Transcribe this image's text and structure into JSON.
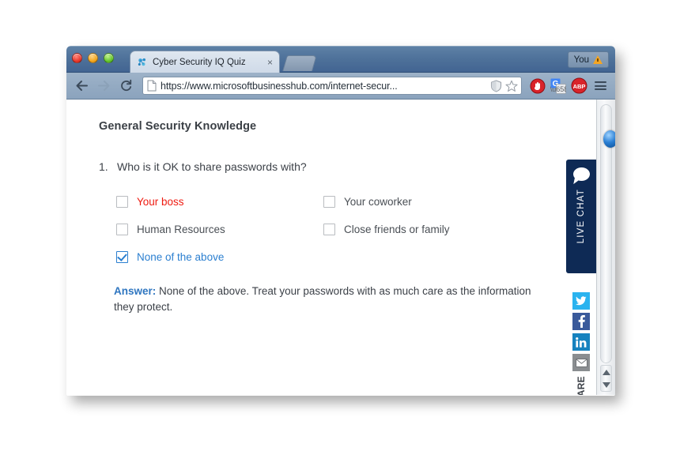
{
  "browser": {
    "window_controls": [
      {
        "name": "close",
        "color": "#e8392c"
      },
      {
        "name": "minimize",
        "color": "#f3a71d"
      },
      {
        "name": "zoom",
        "color": "#66c72e"
      }
    ],
    "tab": {
      "title": "Cyber Security IQ Quiz",
      "favicon": "molecule-icon",
      "close_label": "×"
    },
    "new_tab_label": "",
    "profile": {
      "label": "You",
      "warning_icon": "warning-triangle-icon"
    },
    "nav": {
      "back_icon": "arrow-left-icon",
      "forward_icon": "arrow-right-icon",
      "reload_icon": "reload-icon"
    },
    "address_bar": {
      "page_icon": "page-document-icon",
      "url": "https://www.microsoftbusinesshub.com/internet-secur...",
      "url_prefix": "https://www.microsoftbusinesshub.com",
      "url_suffix": "/internet-secur...",
      "shield_icon": "shield-icon",
      "bookmark_icon": "star-icon"
    },
    "extensions": [
      {
        "name": "block-stop-icon",
        "label": "",
        "color": "#d9232a"
      },
      {
        "name": "google-translate-icon",
        "label": "G",
        "color": "#4285f4"
      },
      {
        "name": "adblock-plus-icon",
        "label": "ABP",
        "color": "#d9232a"
      }
    ],
    "menu_icon": "hamburger-menu-icon"
  },
  "page": {
    "heading": "General Security Knowledge",
    "question": {
      "number": "1.",
      "text": "Who is it OK to share passwords with?"
    },
    "options": [
      {
        "label": "Your boss",
        "checked": false,
        "color": "red"
      },
      {
        "label": "Your coworker",
        "checked": false,
        "color": "gray"
      },
      {
        "label": "Human Resources",
        "checked": false,
        "color": "gray"
      },
      {
        "label": "Close friends or family",
        "checked": false,
        "color": "gray"
      },
      {
        "label": "None of the above",
        "checked": true,
        "color": "blue"
      }
    ],
    "answer": {
      "label": "Answer:",
      "text": " None of the above. Treat your passwords with as much care as the information they protect."
    }
  },
  "widgets": {
    "live_chat": {
      "label": "LIVE CHAT",
      "icon": "speech-bubble-icon",
      "background": "#0e2a55"
    },
    "share": {
      "word": "ARE",
      "buttons": [
        {
          "name": "twitter",
          "glyph": "т",
          "color": "#2ab3ef"
        },
        {
          "name": "facebook",
          "glyph": "f",
          "color": "#3a5a9b"
        },
        {
          "name": "linkedin",
          "glyph": "in",
          "color": "#1682bf"
        },
        {
          "name": "email",
          "glyph": "✉",
          "color": "#8a8d90"
        }
      ]
    }
  },
  "scrollbar": {
    "up_arrow": "arrow-up-icon",
    "down_arrow": "arrow-down-icon",
    "thumb": "scrollbar-thumb"
  }
}
